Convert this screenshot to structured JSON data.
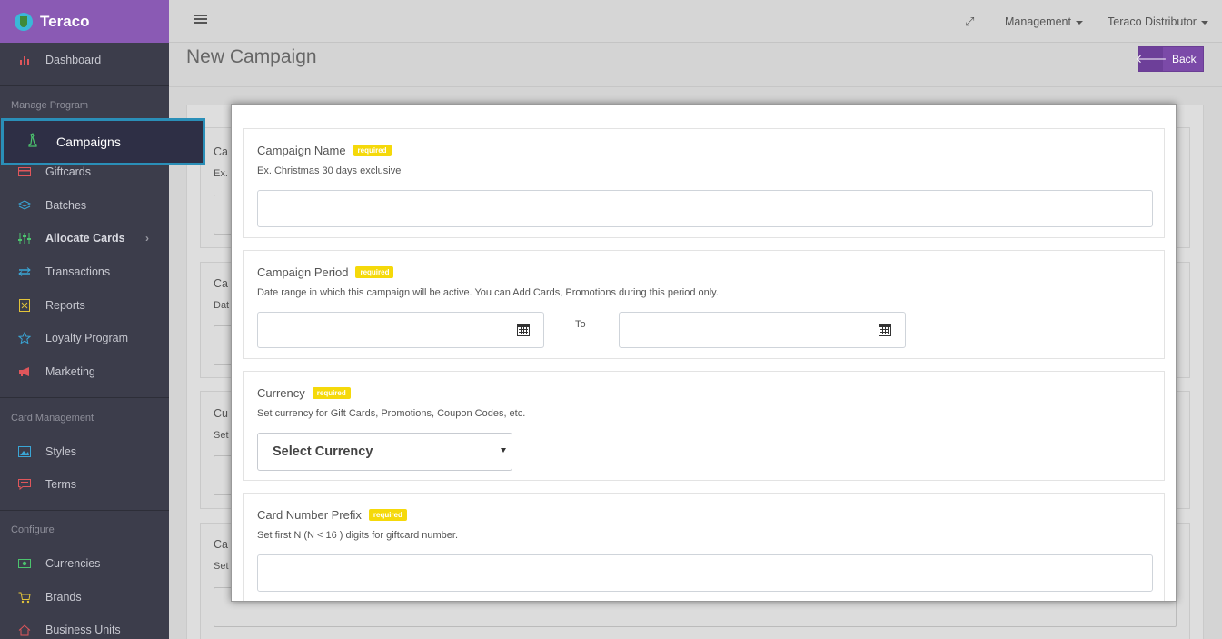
{
  "brand": {
    "name": "Teraco"
  },
  "topbar": {
    "management": "Management",
    "distributor": "Teraco Distributor"
  },
  "page": {
    "title": "New Campaign",
    "back_label": "Back"
  },
  "sidebar": {
    "dashboard": "Dashboard",
    "section_manage": "Manage Program",
    "campaigns": "Campaigns",
    "giftcards": "Giftcards",
    "batches": "Batches",
    "allocate_cards": "Allocate Cards",
    "transactions": "Transactions",
    "reports": "Reports",
    "loyalty_program": "Loyalty Program",
    "marketing": "Marketing",
    "section_card": "Card Management",
    "styles": "Styles",
    "terms": "Terms",
    "section_configure": "Configure",
    "currencies": "Currencies",
    "brands": "Brands",
    "business_units": "Business Units"
  },
  "background_form": {
    "labels": [
      "Ca",
      "Ex.",
      "Ca",
      "Dat",
      "Cu",
      "Set",
      "Ca",
      "Set"
    ]
  },
  "form": {
    "required_badge": "required",
    "campaign_name": {
      "label": "Campaign Name",
      "help": "Ex. Christmas 30 days exclusive",
      "value": ""
    },
    "campaign_period": {
      "label": "Campaign Period",
      "help": "Date range in which this campaign will be active. You can Add Cards, Promotions during this period only.",
      "to_label": "To",
      "start": "",
      "end": ""
    },
    "currency": {
      "label": "Currency",
      "help": "Set currency for Gift Cards, Promotions, Coupon Codes, etc.",
      "selected": "Select Currency"
    },
    "card_prefix": {
      "label": "Card Number Prefix",
      "help": "Set first N (N < 16 ) digits for giftcard number.",
      "value": ""
    }
  },
  "colors": {
    "brand": "#8a5ab4",
    "sidebar": "#3c3d4b",
    "required": "#f5d90a",
    "highlight_border": "#2a8fb8",
    "back_button": "#7b4aa8"
  }
}
